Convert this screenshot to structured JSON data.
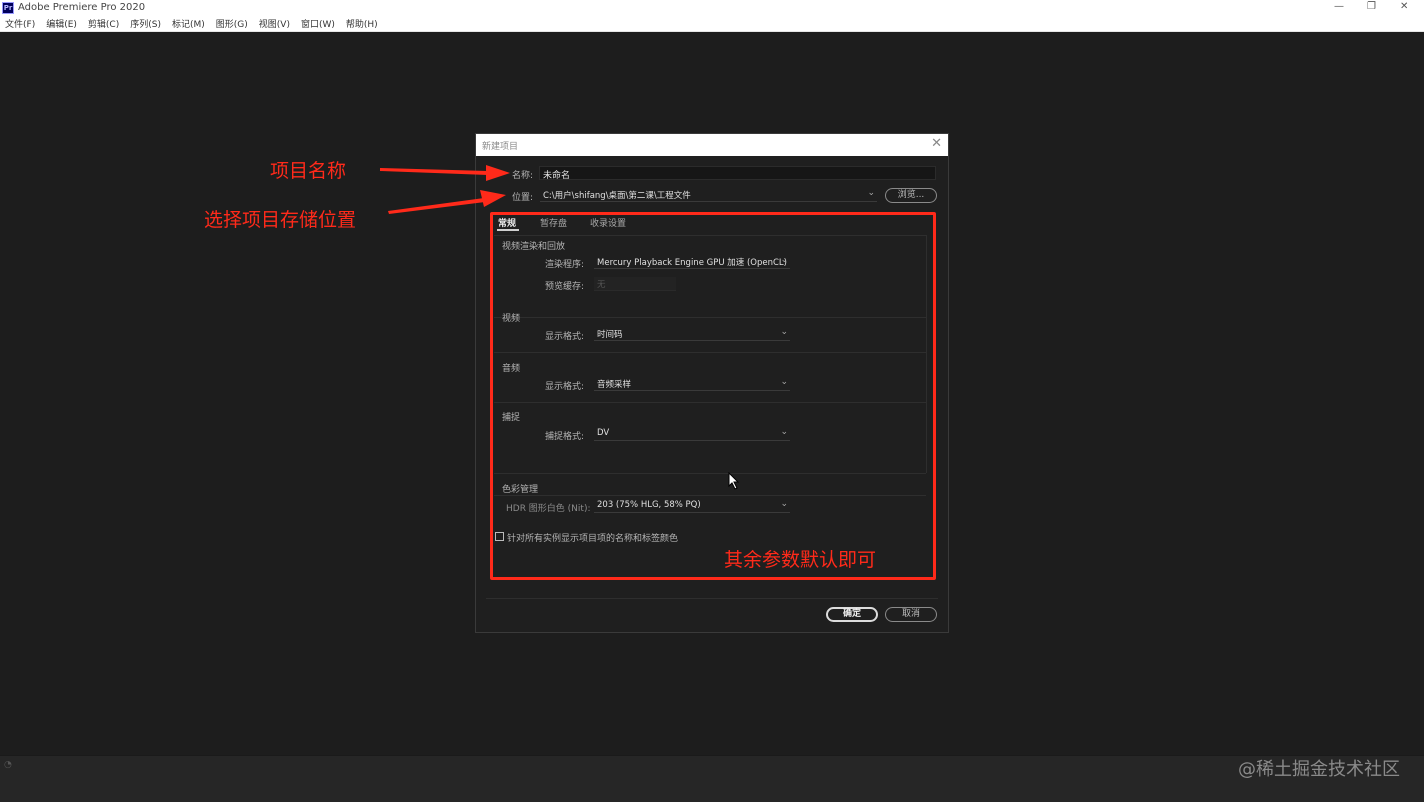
{
  "app": {
    "icon_label": "Pr",
    "title": "Adobe Premiere Pro 2020"
  },
  "window_controls": {
    "minimize": "—",
    "restore": "❐",
    "close": "✕"
  },
  "menu": [
    "文件(F)",
    "编辑(E)",
    "剪辑(C)",
    "序列(S)",
    "标记(M)",
    "图形(G)",
    "视图(V)",
    "窗口(W)",
    "帮助(H)"
  ],
  "dialog": {
    "title": "新建项目",
    "close": "✕",
    "name_label": "名称:",
    "name_value": "未命名",
    "location_label": "位置:",
    "location_value": "C:\\用户\\shifang\\桌面\\第二课\\工程文件",
    "browse_button": "浏览...",
    "tabs": [
      "常规",
      "暂存盘",
      "收录设置"
    ],
    "sections": {
      "video_render": {
        "heading": "视频渲染和回放",
        "renderer_label": "渲染程序:",
        "renderer_value": "Mercury Playback Engine GPU 加速 (OpenCL)",
        "preview_cache_label": "预览缓存:",
        "preview_cache_value": "无"
      },
      "video": {
        "heading": "视频",
        "display_format_label": "显示格式:",
        "display_format_value": "时间码"
      },
      "audio": {
        "heading": "音频",
        "display_format_label": "显示格式:",
        "display_format_value": "音频采样"
      },
      "capture": {
        "heading": "捕捉",
        "capture_format_label": "捕捉格式:",
        "capture_format_value": "DV"
      },
      "color": {
        "heading": "色彩管理",
        "hdr_label": "HDR 图形白色 (Nit):",
        "hdr_value": "203 (75% HLG, 58% PQ)"
      }
    },
    "checkbox_label": "针对所有实例显示项目项的名称和标签颜色",
    "checkbox_checked": false,
    "ok_button": "确定",
    "cancel_button": "取消"
  },
  "annotations": {
    "project_name": "项目名称",
    "storage_location": "选择项目存储位置",
    "defaults_note": "其余参数默认即可",
    "color": "#ff2a1a"
  },
  "watermark": "@稀土掘金技术社区"
}
